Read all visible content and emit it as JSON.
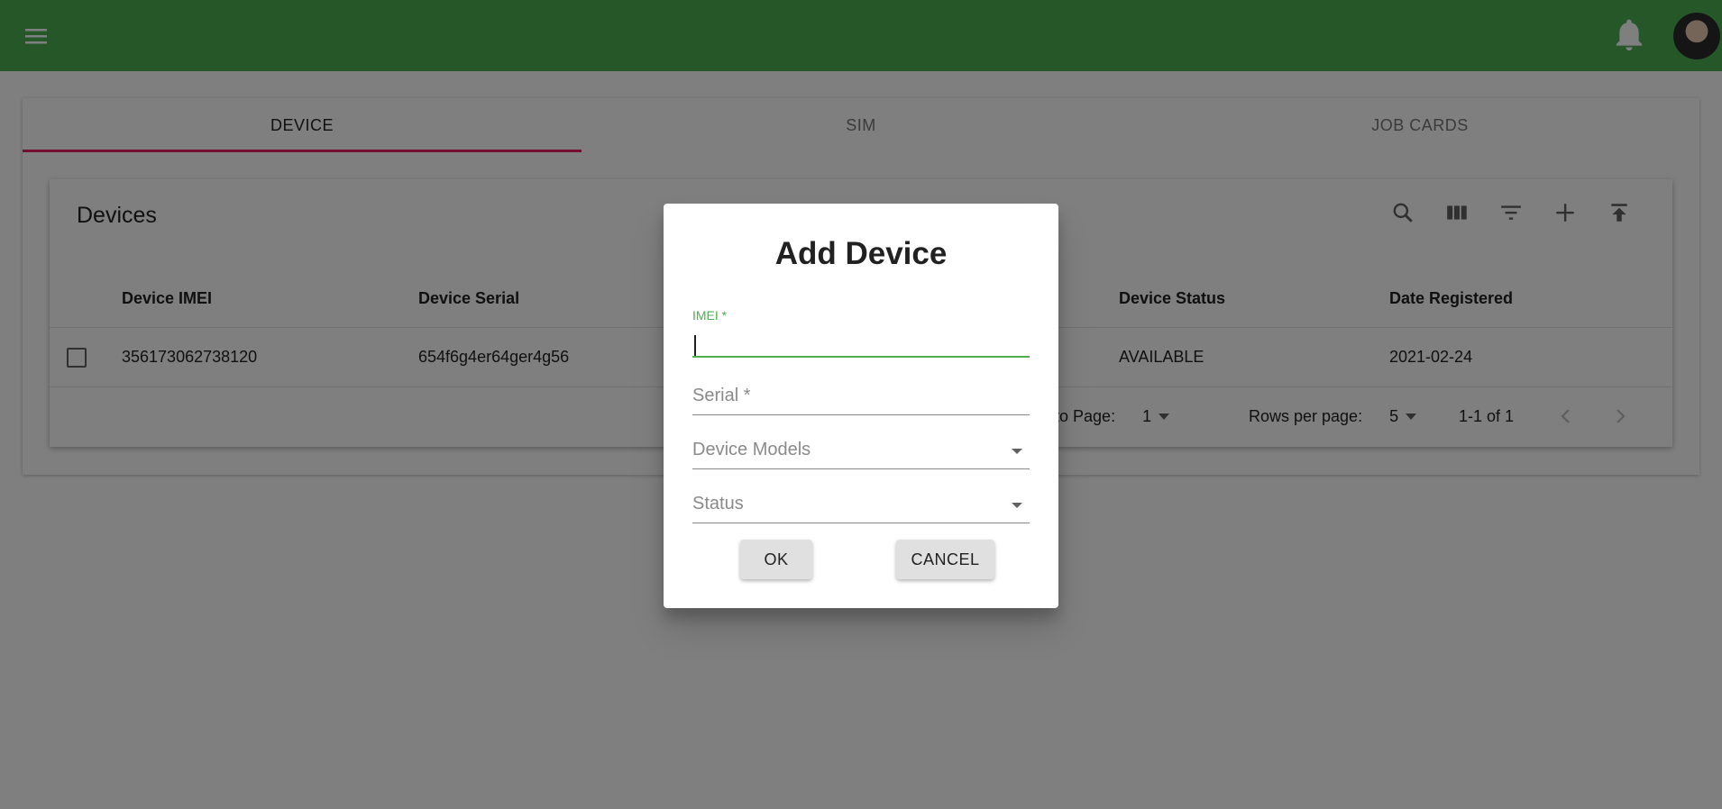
{
  "appbar": {
    "menu_icon": "menu-icon",
    "bell_icon": "bell-icon",
    "avatar": "user-avatar"
  },
  "tabs": [
    {
      "label": "DEVICE",
      "active": true
    },
    {
      "label": "SIM",
      "active": false
    },
    {
      "label": "JOB CARDS",
      "active": false
    }
  ],
  "table": {
    "title": "Devices",
    "toolbar": [
      "search-icon",
      "view-columns-icon",
      "filter-icon",
      "add-icon",
      "upload-icon"
    ],
    "columns": [
      "Device IMEI",
      "Device Serial",
      "Device Status",
      "Date Registered"
    ],
    "rows": [
      {
        "imei": "356173062738120",
        "serial": "654f6g4er64ger4g56",
        "status": "AVAILABLE",
        "date": "2021-02-24"
      }
    ],
    "footer": {
      "jump_label": "p to Page:",
      "jump_value": "1",
      "rows_per_page_label": "Rows per page:",
      "rows_per_page_value": "5",
      "range": "1-1 of 1"
    }
  },
  "dialog": {
    "title": "Add Device",
    "imei_label": "IMEI *",
    "imei_value": "",
    "serial_placeholder": "Serial *",
    "models_placeholder": "Device Models",
    "status_placeholder": "Status",
    "ok_label": "OK",
    "cancel_label": "CANCEL"
  },
  "colors": {
    "appbar": "#4caf50",
    "tab_indicator": "#e91e63",
    "focus": "#4caf50"
  }
}
